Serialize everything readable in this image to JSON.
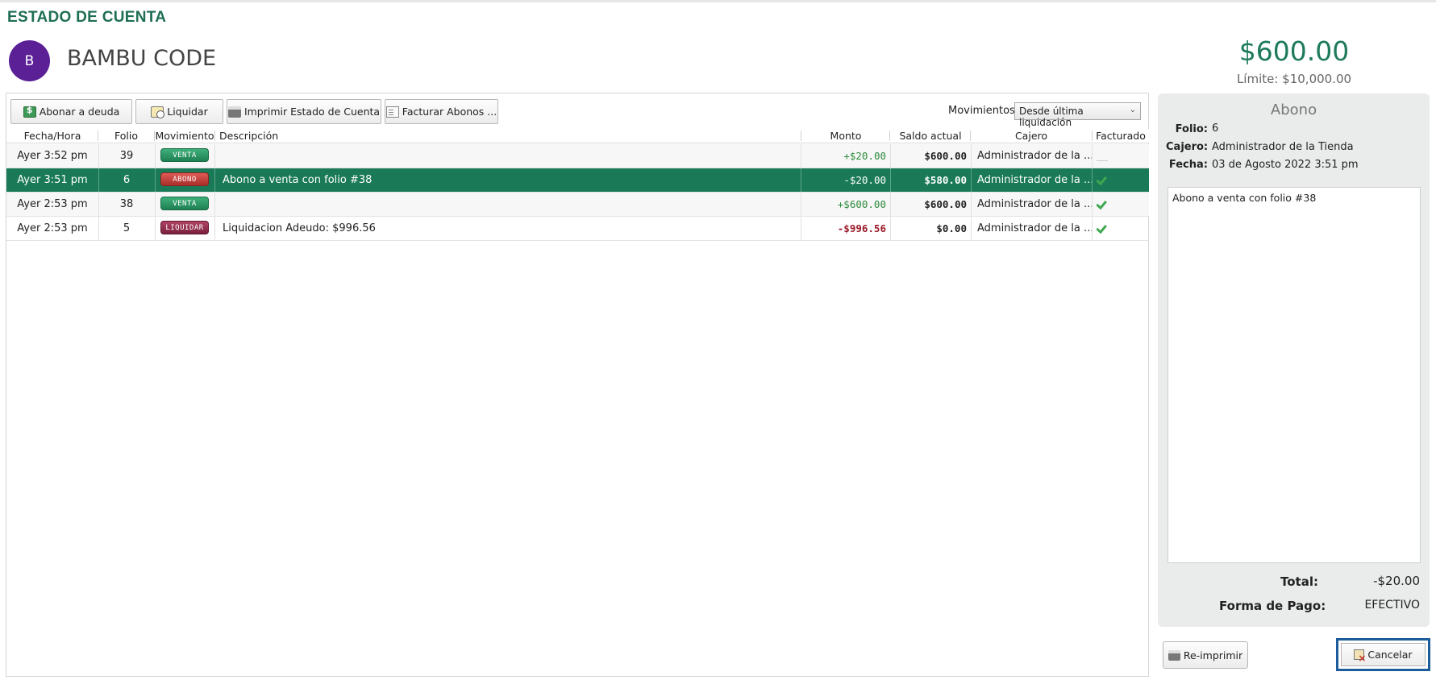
{
  "page_title": "ESTADO DE CUENTA",
  "customer": {
    "initial": "B",
    "name": "BAMBU CODE"
  },
  "balance": {
    "amount": "$600.00",
    "limit": "Límite: $10,000.00"
  },
  "toolbar": {
    "abonar_label": "Abonar a deuda",
    "liquidar_label": "Liquidar",
    "imprimir_label": "Imprimir Estado de Cuenta",
    "facturar_label": "Facturar Abonos ...",
    "movimientos_label": "Movimientos:",
    "movimientos_value": "Desde última liquidación"
  },
  "table": {
    "headers": [
      "Fecha/Hora",
      "Folio",
      "Movimiento",
      "Descripción",
      "Monto",
      "Saldo actual",
      "Cajero",
      "Facturado"
    ],
    "rows": [
      {
        "fecha": "Ayer 3:52 pm",
        "folio": "39",
        "movimiento": "VENTA",
        "descripcion": "",
        "monto": "+$20.00",
        "saldo": "$600.00",
        "cajero": "Administrador de la ...",
        "facturado": false
      },
      {
        "fecha": "Ayer 3:51 pm",
        "folio": "6",
        "movimiento": "ABONO",
        "descripcion": "Abono a venta con folio #38",
        "monto": "-$20.00",
        "saldo": "$580.00",
        "cajero": "Administrador de la ...",
        "facturado": true
      },
      {
        "fecha": "Ayer 2:53 pm",
        "folio": "38",
        "movimiento": "VENTA",
        "descripcion": "",
        "monto": "+$600.00",
        "saldo": "$600.00",
        "cajero": "Administrador de la ...",
        "facturado": true
      },
      {
        "fecha": "Ayer 2:53 pm",
        "folio": "5",
        "movimiento": "LIQUIDAR",
        "descripcion": "Liquidacion Adeudo: $996.56",
        "monto": "-$996.56",
        "saldo": "$0.00",
        "cajero": "Administrador de la ...",
        "facturado": true
      }
    ]
  },
  "detail": {
    "title": "Abono",
    "folio_label": "Folio:",
    "folio_value": "6",
    "cajero_label": "Cajero:",
    "cajero_value": "Administrador de la Tienda",
    "fecha_label": "Fecha:",
    "fecha_value": "03 de Agosto 2022 3:51 pm",
    "notes": "Abono a venta con folio #38",
    "total_label": "Total:",
    "total_value": "-$20.00",
    "forma_label": "Forma de Pago:",
    "forma_value": "EFECTIVO"
  },
  "actions": {
    "reimprimir_label": "Re-imprimir",
    "cancelar_label": "Cancelar"
  },
  "colors": {
    "accent": "#1a7a58",
    "avatar": "#5b1f96",
    "balance": "#1e7a5c",
    "focus_border": "#1c5c9b"
  }
}
